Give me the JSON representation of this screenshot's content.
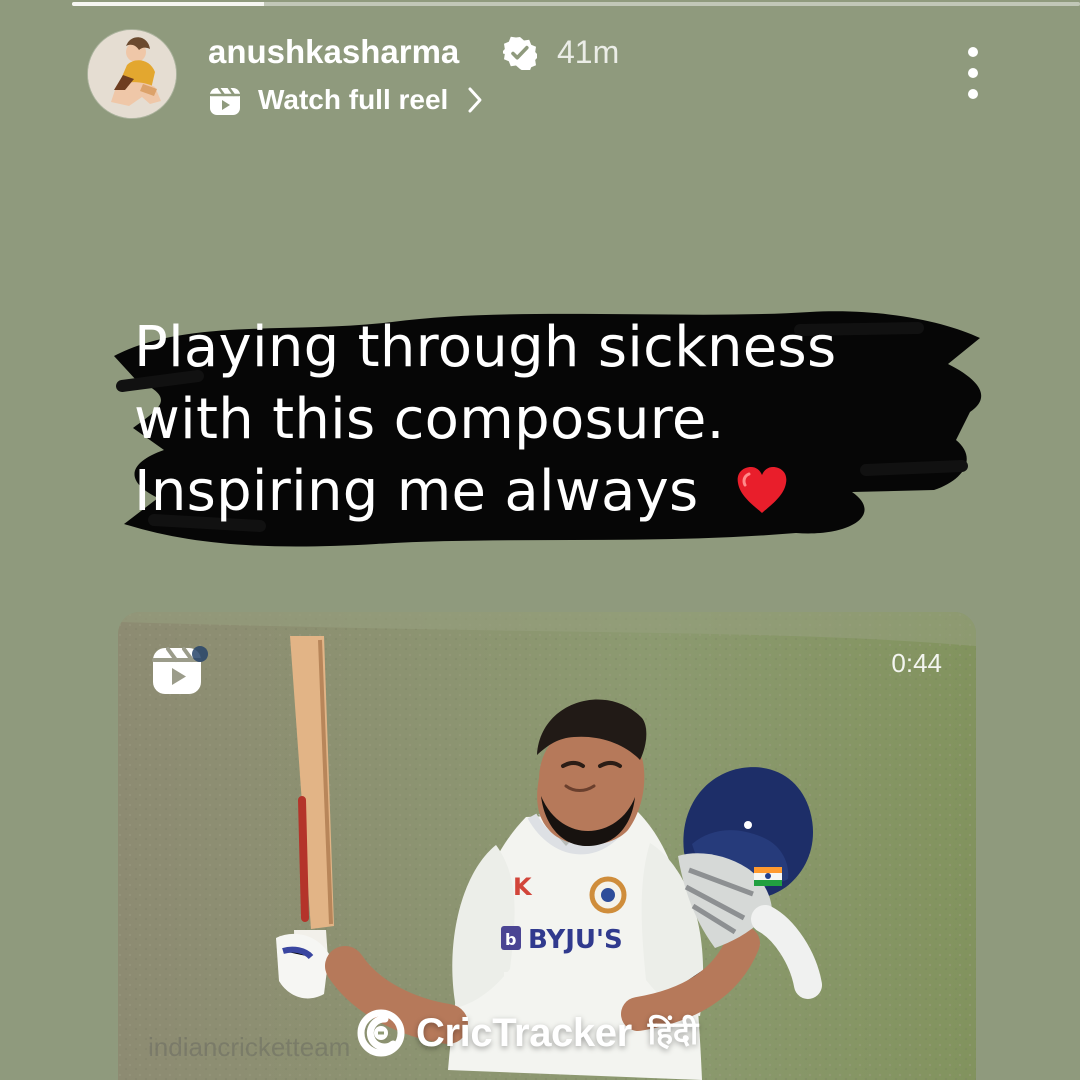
{
  "story": {
    "progress_fraction": 0.19,
    "progress_colors": {
      "track": "#d6d9d0",
      "fill": "#f6f6f2"
    },
    "background": "#8f9a7d"
  },
  "header": {
    "username": "anushkasharma",
    "verified_icon": "verified-badge-icon",
    "time_ago": "41m",
    "reel_icon": "reels-icon",
    "reel_link_label": "Watch full reel",
    "chevron_icon": "chevron-right-icon",
    "menu_icon": "more-vertical-icon"
  },
  "caption": {
    "lines": [
      "Playing through sickness",
      "with this composure.",
      "Inspiring me always"
    ],
    "heart_icon": "heart-icon"
  },
  "video": {
    "reel_icon": "reels-icon",
    "duration": "0:44",
    "source_handle": "indiancricketteam",
    "jersey_brand": "BYJU'S"
  },
  "watermark": {
    "logo_icon": "crictracker-logo-icon",
    "brand": "CricTracker",
    "language": "हिंदी"
  }
}
